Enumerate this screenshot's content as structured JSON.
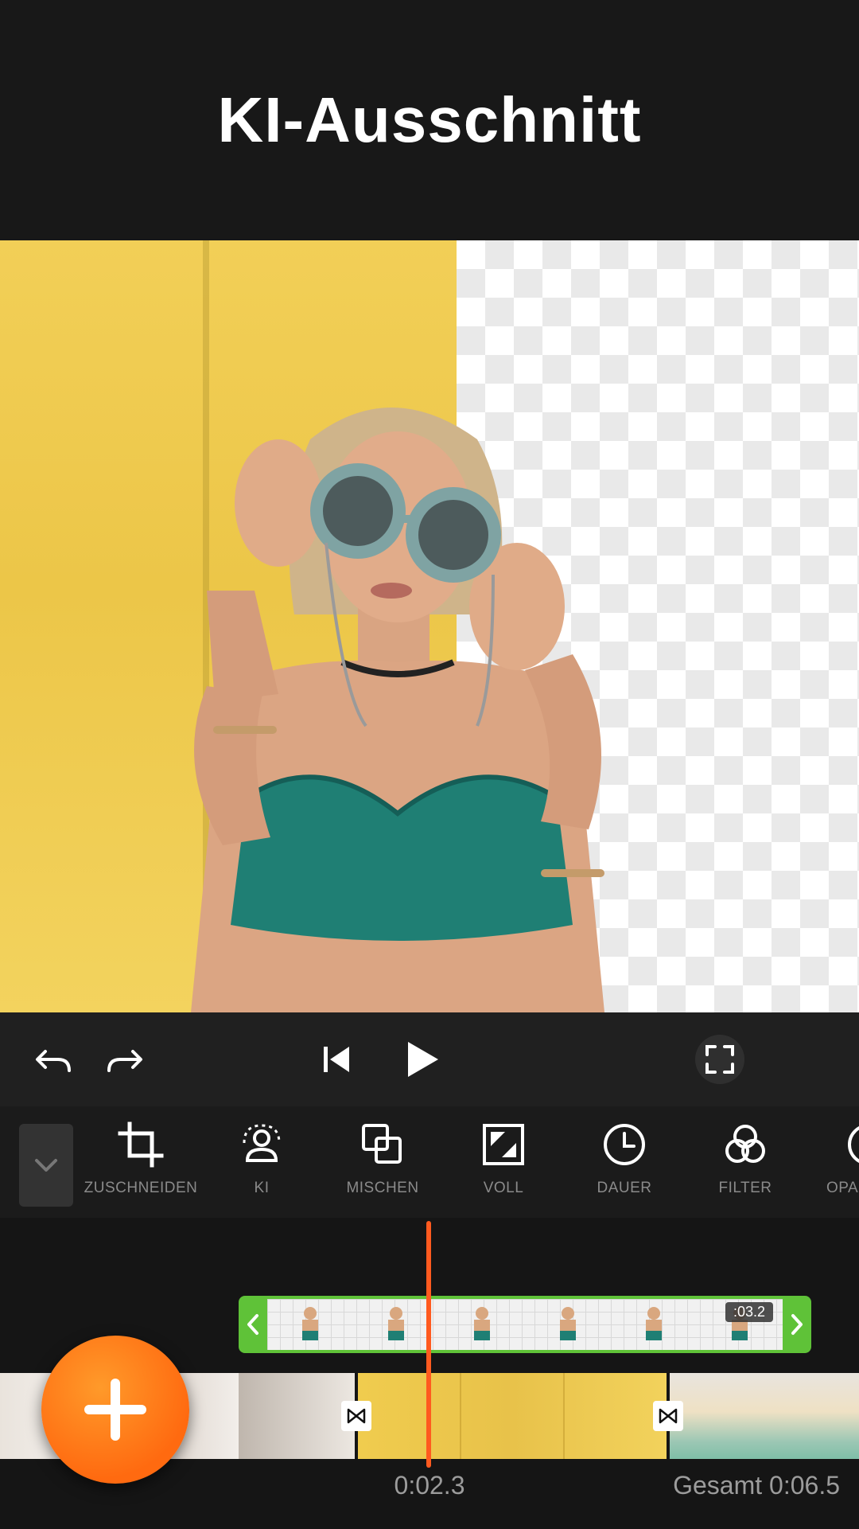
{
  "header": {
    "title": "KI-Ausschnitt"
  },
  "colors": {
    "accent": "#ff6a10",
    "playhead": "#ff5a1f",
    "clip_green": "#5fc238",
    "background": "#181818"
  },
  "controls": {
    "undo": "undo-icon",
    "redo": "redo-icon",
    "skip_start": "skip-start-icon",
    "play": "play-icon",
    "fullscreen": "fullscreen-icon"
  },
  "tools": {
    "items": [
      {
        "label": "ZUSCHNEIDEN",
        "icon": "crop-icon"
      },
      {
        "label": "KI",
        "icon": "ai-person-icon"
      },
      {
        "label": "MISCHEN",
        "icon": "blend-icon"
      },
      {
        "label": "VOLL",
        "icon": "fill-icon"
      },
      {
        "label": "DAUER",
        "icon": "clock-icon"
      },
      {
        "label": "FILTER",
        "icon": "filter-icon"
      },
      {
        "label": "OPA",
        "icon": "opacity-icon"
      }
    ]
  },
  "timeline": {
    "clip_duration": ":03.2",
    "current_time": "0:02.3",
    "total_time": "Gesamt 0:06.5"
  }
}
